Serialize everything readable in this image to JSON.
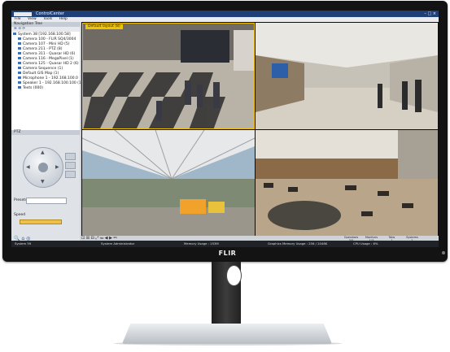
{
  "app": {
    "title": "ControlCenter",
    "window_controls": "– □ ×"
  },
  "menu": [
    "File",
    "View",
    "Tools",
    "Help"
  ],
  "navigation": {
    "title": "Navigation Tree",
    "toolbar": "⊕ ⊖ ⟳",
    "items": [
      "System 38 [192.168.100.58]",
      "Camera 100 - FLIR SQ4/3004",
      "Camera 107 - Mini HD (5)",
      "Camera 211 - PTZ (8)",
      "Camera 311 - Quasar HD (6)",
      "Camera 116 - MegaPixel (1)",
      "Camera 125 - Quasar HD 2 (6)",
      "Camera Sequence (1)",
      "Default GIS Map (1)",
      "Microphone 1 - 192.168.100.0",
      "Speaker 1 - 192.168.100.100 (1)",
      "Texts (000)"
    ]
  },
  "ptz": {
    "title": "PTZ",
    "presets_label": "Presets",
    "speed_label": "Speed"
  },
  "video": {
    "layout_label": "Default layout (8)",
    "toolbar": "⊡ ⊞ ⊟ ⤢ ⏮ ◀ ▶ ⏭"
  },
  "stats": {
    "headers": [
      "Operators",
      "Monitors",
      "Tabs",
      "Systems"
    ],
    "values": [
      "3/5",
      "1/3",
      "1",
      "1"
    ],
    "extra": "Bandwidth 1.0 MB"
  },
  "status": {
    "system": "System 59",
    "user": "System Administrator",
    "memory": "Memory Usage : 153M",
    "graphics": "Graphics Memory Usage : 256 / 2048K",
    "cpu": "CPU Usage : 6%"
  },
  "brand": "FLIR"
}
